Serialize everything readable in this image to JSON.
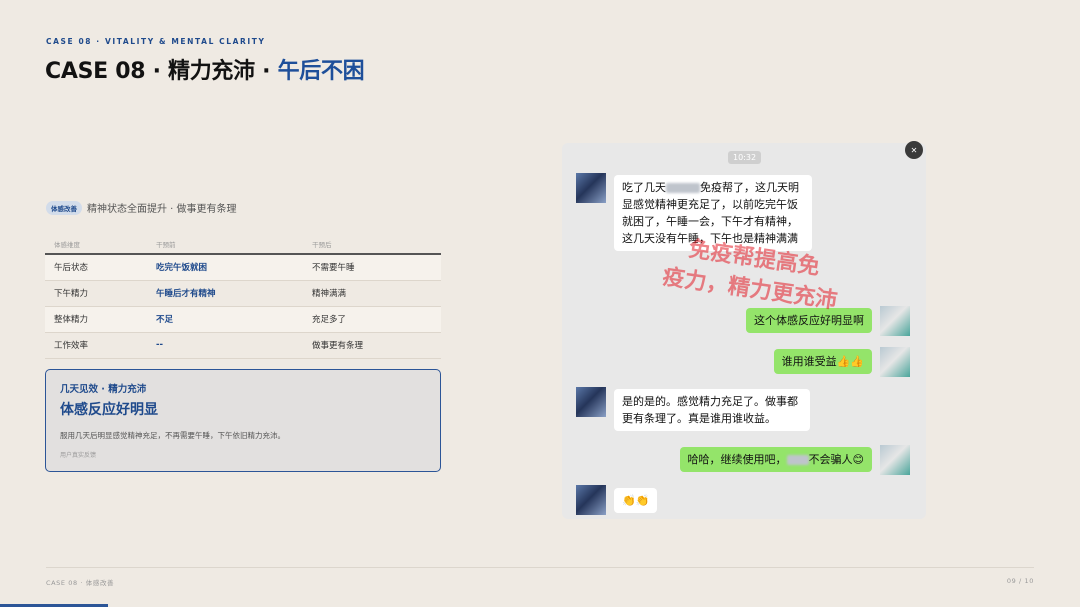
{
  "header": {
    "eyebrow": "CASE 08 · VITALITY & MENTAL CLARITY",
    "title_main": "CASE 08 · 精力充沛 · ",
    "title_accent": "午后不困"
  },
  "summary": {
    "badge": "体感改善",
    "text": "精神状态全面提升 · 做事更有条理"
  },
  "table": {
    "headers": [
      "体感维度",
      "干预前",
      "干预后"
    ],
    "rows": [
      [
        "午后状态",
        "吃完午饭就困",
        "不需要午睡"
      ],
      [
        "下午精力",
        "午睡后才有精神",
        "精神满满"
      ],
      [
        "整体精力",
        "不足",
        "充足多了"
      ],
      [
        "工作效率",
        "--",
        "做事更有条理"
      ]
    ]
  },
  "callout": {
    "eyebrow": "几天见效 · 精力充沛",
    "title": "体感反应好明显",
    "body": "服用几天后明显感觉精神充足，不再需要午睡，下午依旧精力充沛。",
    "source": "用户真实反馈"
  },
  "chat": {
    "time": "10:32",
    "close_icon": "close-icon",
    "messages": [
      {
        "side": "left",
        "before": "吃了几天",
        "after": "免疫帮了，这几天明显感觉精神更充足了，以前吃完午饭就困了，午睡一会，下午才有精神，这几天没有午睡，下午也是精神满满"
      },
      {
        "side": "right",
        "before": "这个体感反应好明显啊",
        "after": ""
      },
      {
        "side": "right",
        "before": "谁用谁受益👍👍",
        "after": ""
      },
      {
        "side": "left",
        "before": "是的是的。感觉精力充足了。做事都更有条理了。真是谁用谁收益。",
        "after": ""
      },
      {
        "side": "right",
        "before": "哈哈，继续使用吧，",
        "after": "不会骗人😊"
      },
      {
        "side": "left",
        "before": "👏👏",
        "after": ""
      }
    ],
    "watermark_line1": "免疫帮提高免",
    "watermark_line2": "疫力，精力更充沛"
  },
  "footer": {
    "left": "CASE 08 · 体感改善",
    "right": "09 / 10",
    "progress": 0.1
  },
  "colors": {
    "background": "#efeae3",
    "accent": "#1e4f9a",
    "bubble_green": "#94e46a"
  }
}
